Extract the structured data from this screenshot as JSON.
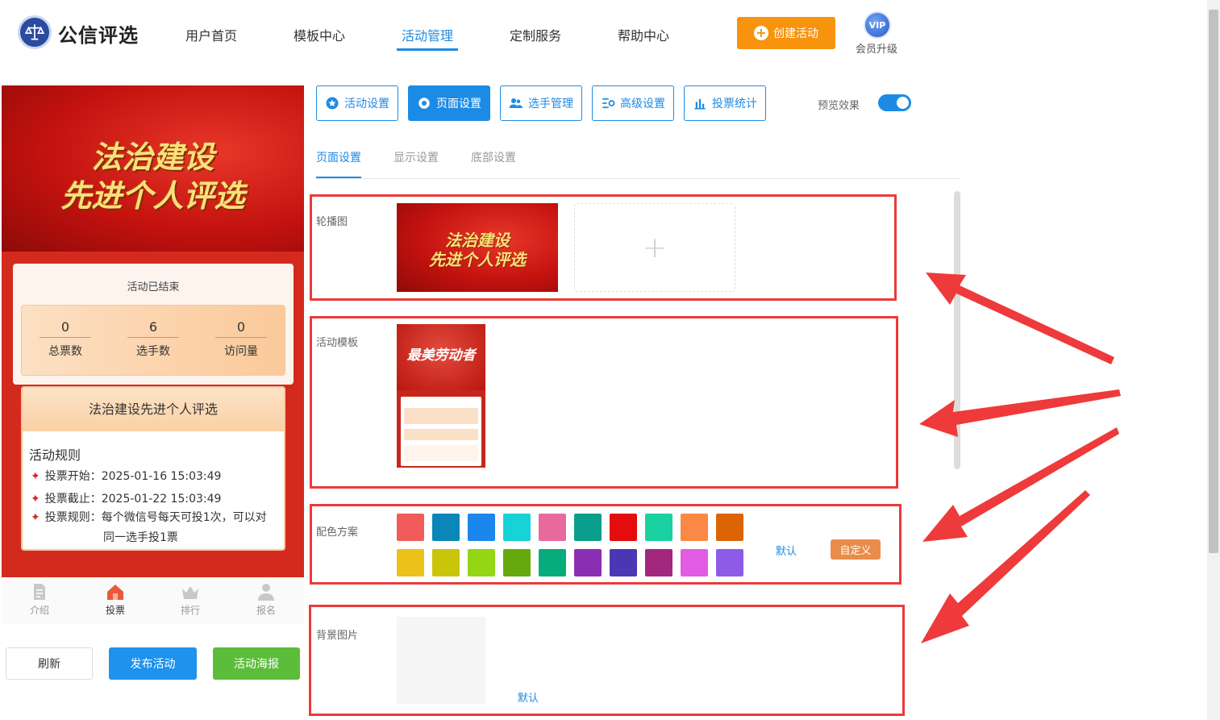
{
  "header": {
    "brand": "公信评选",
    "nav": [
      "用户首页",
      "模板中心",
      "活动管理",
      "定制服务",
      "帮助中心"
    ],
    "active_nav": "活动管理",
    "create_label": "创建活动",
    "vip_badge": "VIP",
    "vip_label": "会员升级"
  },
  "preview": {
    "banner_line1": "法治建设",
    "banner_line2": "先进个人评选",
    "status": "活动已结束",
    "stats": [
      {
        "value": "0",
        "label": "总票数"
      },
      {
        "value": "6",
        "label": "选手数"
      },
      {
        "value": "0",
        "label": "访问量"
      }
    ],
    "activity_title": "法治建设先进个人评选",
    "rules_title": "活动规则",
    "rules": [
      "投票开始：2025-01-16 15:03:49",
      "投票截止：2025-01-22 15:03:49",
      "投票规则：每个微信号每天可投1次，可以对"
    ],
    "rule3_continued": "同一选手投1票",
    "tabs": [
      "介绍",
      "投票",
      "排行",
      "报名"
    ],
    "active_tab": "投票"
  },
  "actions": {
    "refresh": "刷新",
    "publish": "发布活动",
    "poster": "活动海报"
  },
  "settings": {
    "tabs": [
      "活动设置",
      "页面设置",
      "选手管理",
      "高级设置",
      "投票统计"
    ],
    "active_tab": "页面设置",
    "preview_toggle_label": "预览效果",
    "preview_toggle_on": true,
    "subtabs": [
      "页面设置",
      "显示设置",
      "底部设置"
    ],
    "active_subtab": "页面设置"
  },
  "sections": {
    "carousel_label": "轮播图",
    "carousel_image_line1": "法治建设",
    "carousel_image_line2": "先进个人评选",
    "template_label": "活动模板",
    "template_thumb_title": "最美劳动者",
    "colors_label": "配色方案",
    "colors_row1": [
      "#f25b5b",
      "#0b86b9",
      "#1b87ec",
      "#17d2d6",
      "#e8699c",
      "#0a9e8c",
      "#e50c0c",
      "#19d1a1",
      "#fb8844",
      "#dd6405"
    ],
    "colors_row2": [
      "#ebc11a",
      "#c9c50b",
      "#94d514",
      "#66a90f",
      "#08ab7b",
      "#8a2fb3",
      "#4b37b3",
      "#a3277c",
      "#e25be3",
      "#8e5be9"
    ],
    "colors_default": "默认",
    "colors_custom": "自定义",
    "bg_label": "背景图片",
    "bg_default": "默认"
  },
  "colors": {
    "primary": "#1c8be6",
    "highlight_border": "#e93b3b",
    "orange": "#f7930d"
  }
}
